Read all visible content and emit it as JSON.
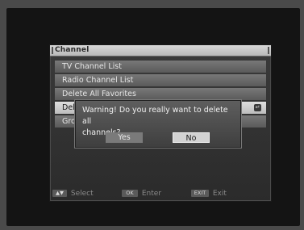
{
  "menu": {
    "title": "Channel",
    "items": [
      {
        "label": "TV Channel List"
      },
      {
        "label": "Radio Channel List"
      },
      {
        "label": "Delete All Favorites"
      },
      {
        "label": "Del"
      },
      {
        "label": "Gro"
      }
    ],
    "enter_icon": "↵"
  },
  "dialog": {
    "message_line1": "Warning! Do you really want to delete all",
    "message_line2": "channels?",
    "yes_label": "Yes",
    "no_label": "No",
    "selected": "No"
  },
  "footer": {
    "select_key": "▲▼",
    "select_label": "Select",
    "enter_key": "OK",
    "enter_label": "Enter",
    "exit_key": "EXIT",
    "exit_label": "Exit"
  }
}
